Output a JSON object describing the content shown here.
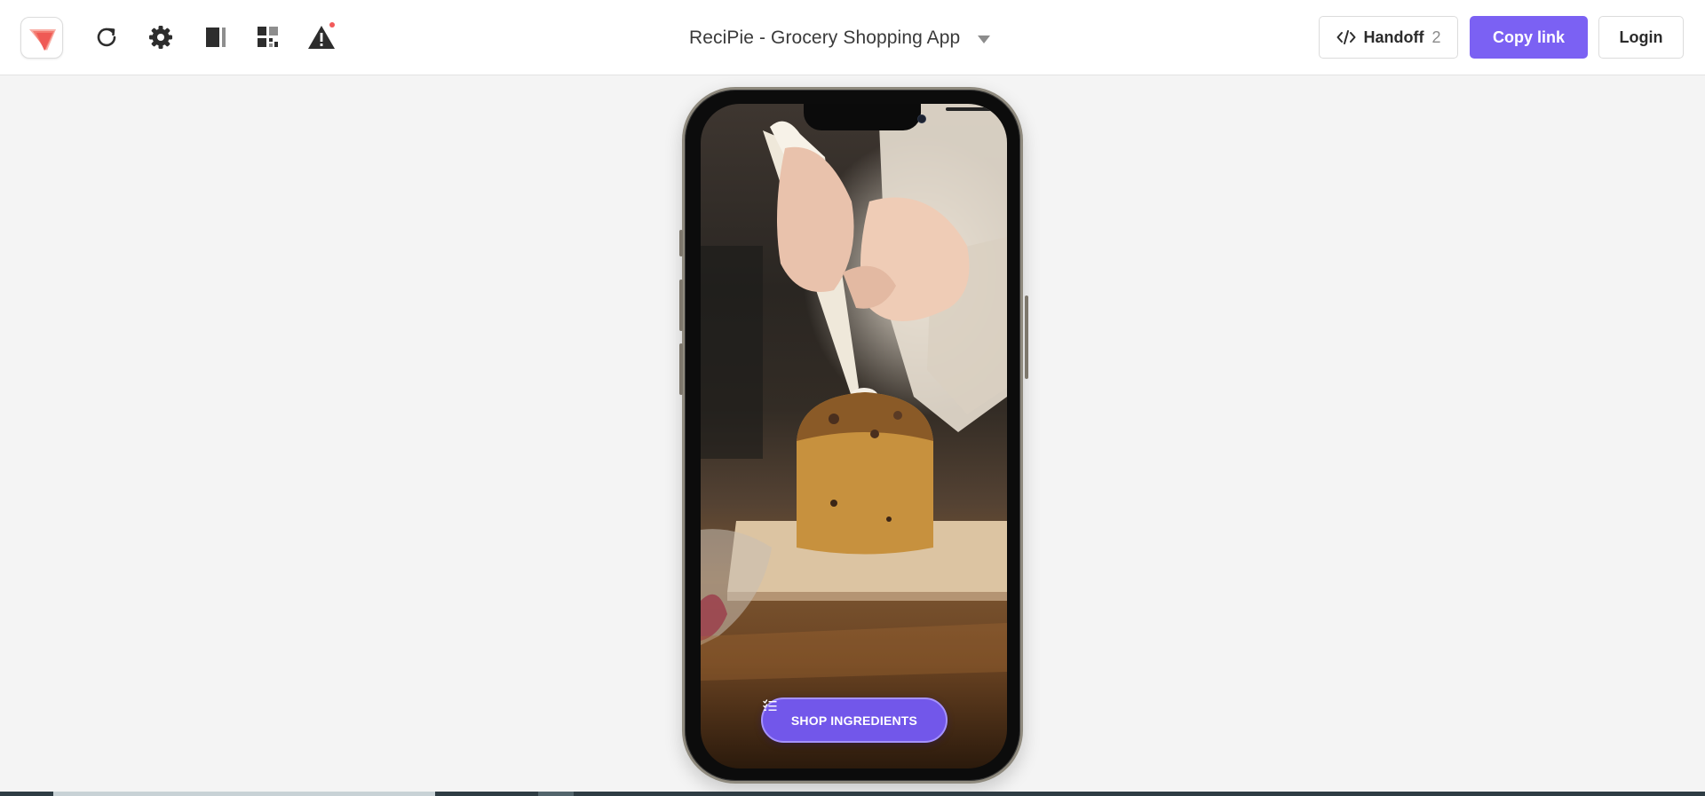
{
  "header": {
    "logo_icon": "recipie-logo-icon",
    "tools": [
      {
        "icon": "refresh-icon"
      },
      {
        "icon": "gear-icon"
      },
      {
        "icon": "panel-toggle-icon"
      },
      {
        "icon": "qr-code-icon"
      },
      {
        "icon": "warning-icon"
      }
    ],
    "project_title": "ReciPie - Grocery Shopping App",
    "handoff_label": "Handoff",
    "handoff_count": "2",
    "copy_link_label": "Copy link",
    "login_label": "Login"
  },
  "preview": {
    "device": "iPhone",
    "cta_label": "SHOP INGREDIENTS",
    "cta_icon": "list-icon"
  },
  "colors": {
    "accent": "#7b61f3",
    "cta": "#7257ea",
    "logo": "#f25a5a",
    "alert_dot": "#f25a5a"
  }
}
